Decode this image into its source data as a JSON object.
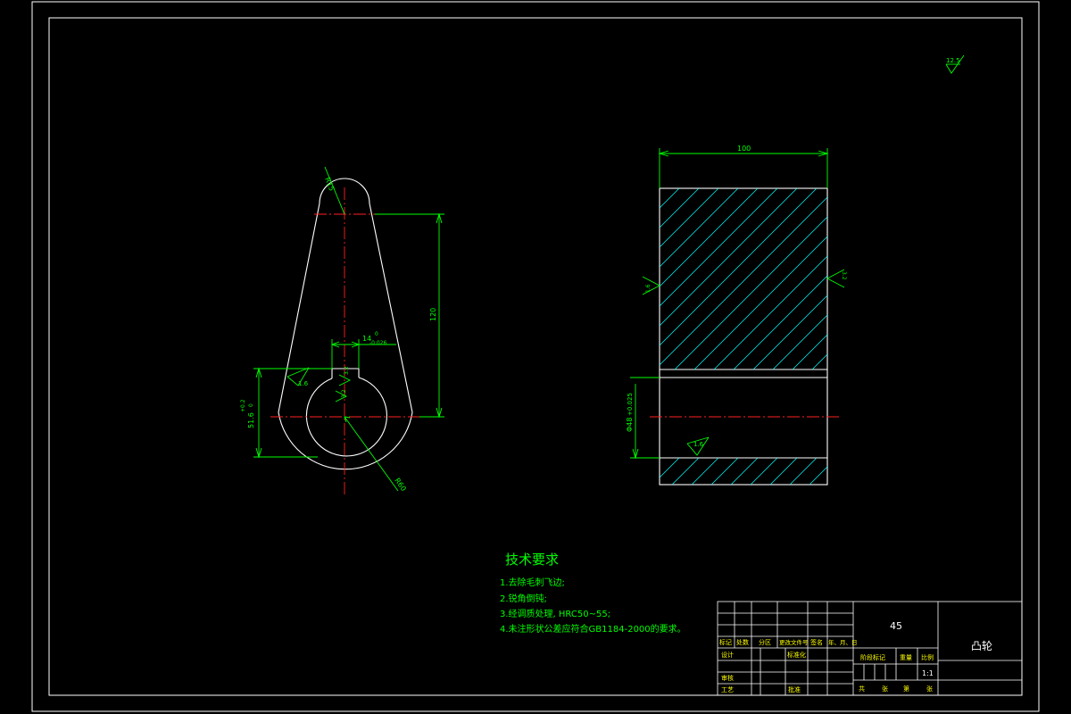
{
  "colors": {
    "background": "#000000",
    "outline": "#ffffff",
    "dimension": "#00ff00",
    "centerline": "#ff2020",
    "hatch": "#00ffff",
    "titleblock_label": "#ffff00"
  },
  "roughness": {
    "global": "12.5",
    "arm_top": "3.2",
    "arm_left": "1.6",
    "keyway_side": "3.2",
    "keyway_bottom": "3.2",
    "section_left": "1.6",
    "section_right": "3.2",
    "bore": "1.6"
  },
  "dimensions": {
    "top_radius": "R15",
    "center_distance": "120",
    "keyway_width": "14",
    "keyway_tol_upper": "0",
    "keyway_tol_lower": "-0.026",
    "keyway_depth": "51.6",
    "keyway_depth_tol_upper": "+0.2",
    "keyway_depth_tol_lower": "0",
    "boss_radius": "R60",
    "section_width": "100",
    "bore_dia": "Φ48",
    "bore_tol": "+0.025"
  },
  "tech_requirements": {
    "title": "技术要求",
    "items": [
      "1.去除毛刺飞边;",
      "2.锐角倒钝;",
      "3.经调质处理, HRC50~55;",
      "4.未注形状公差应符合GB1184-2000的要求。"
    ]
  },
  "title_block": {
    "material": "45",
    "part_name": "凸轮",
    "scale": "1:1",
    "labels": {
      "mark": "标记",
      "count": "处数",
      "zone": "分区",
      "change_doc": "更改文件号",
      "sign": "签名",
      "date": "年、月、日",
      "design": "设计",
      "standardize": "标准化",
      "review": "审核",
      "process": "工艺",
      "approve": "批准",
      "stage_mark": "阶段标记",
      "weight": "重量",
      "ratio": "比例",
      "total": "共",
      "sheets": "张",
      "nth": "第",
      "sheet": "张"
    }
  }
}
